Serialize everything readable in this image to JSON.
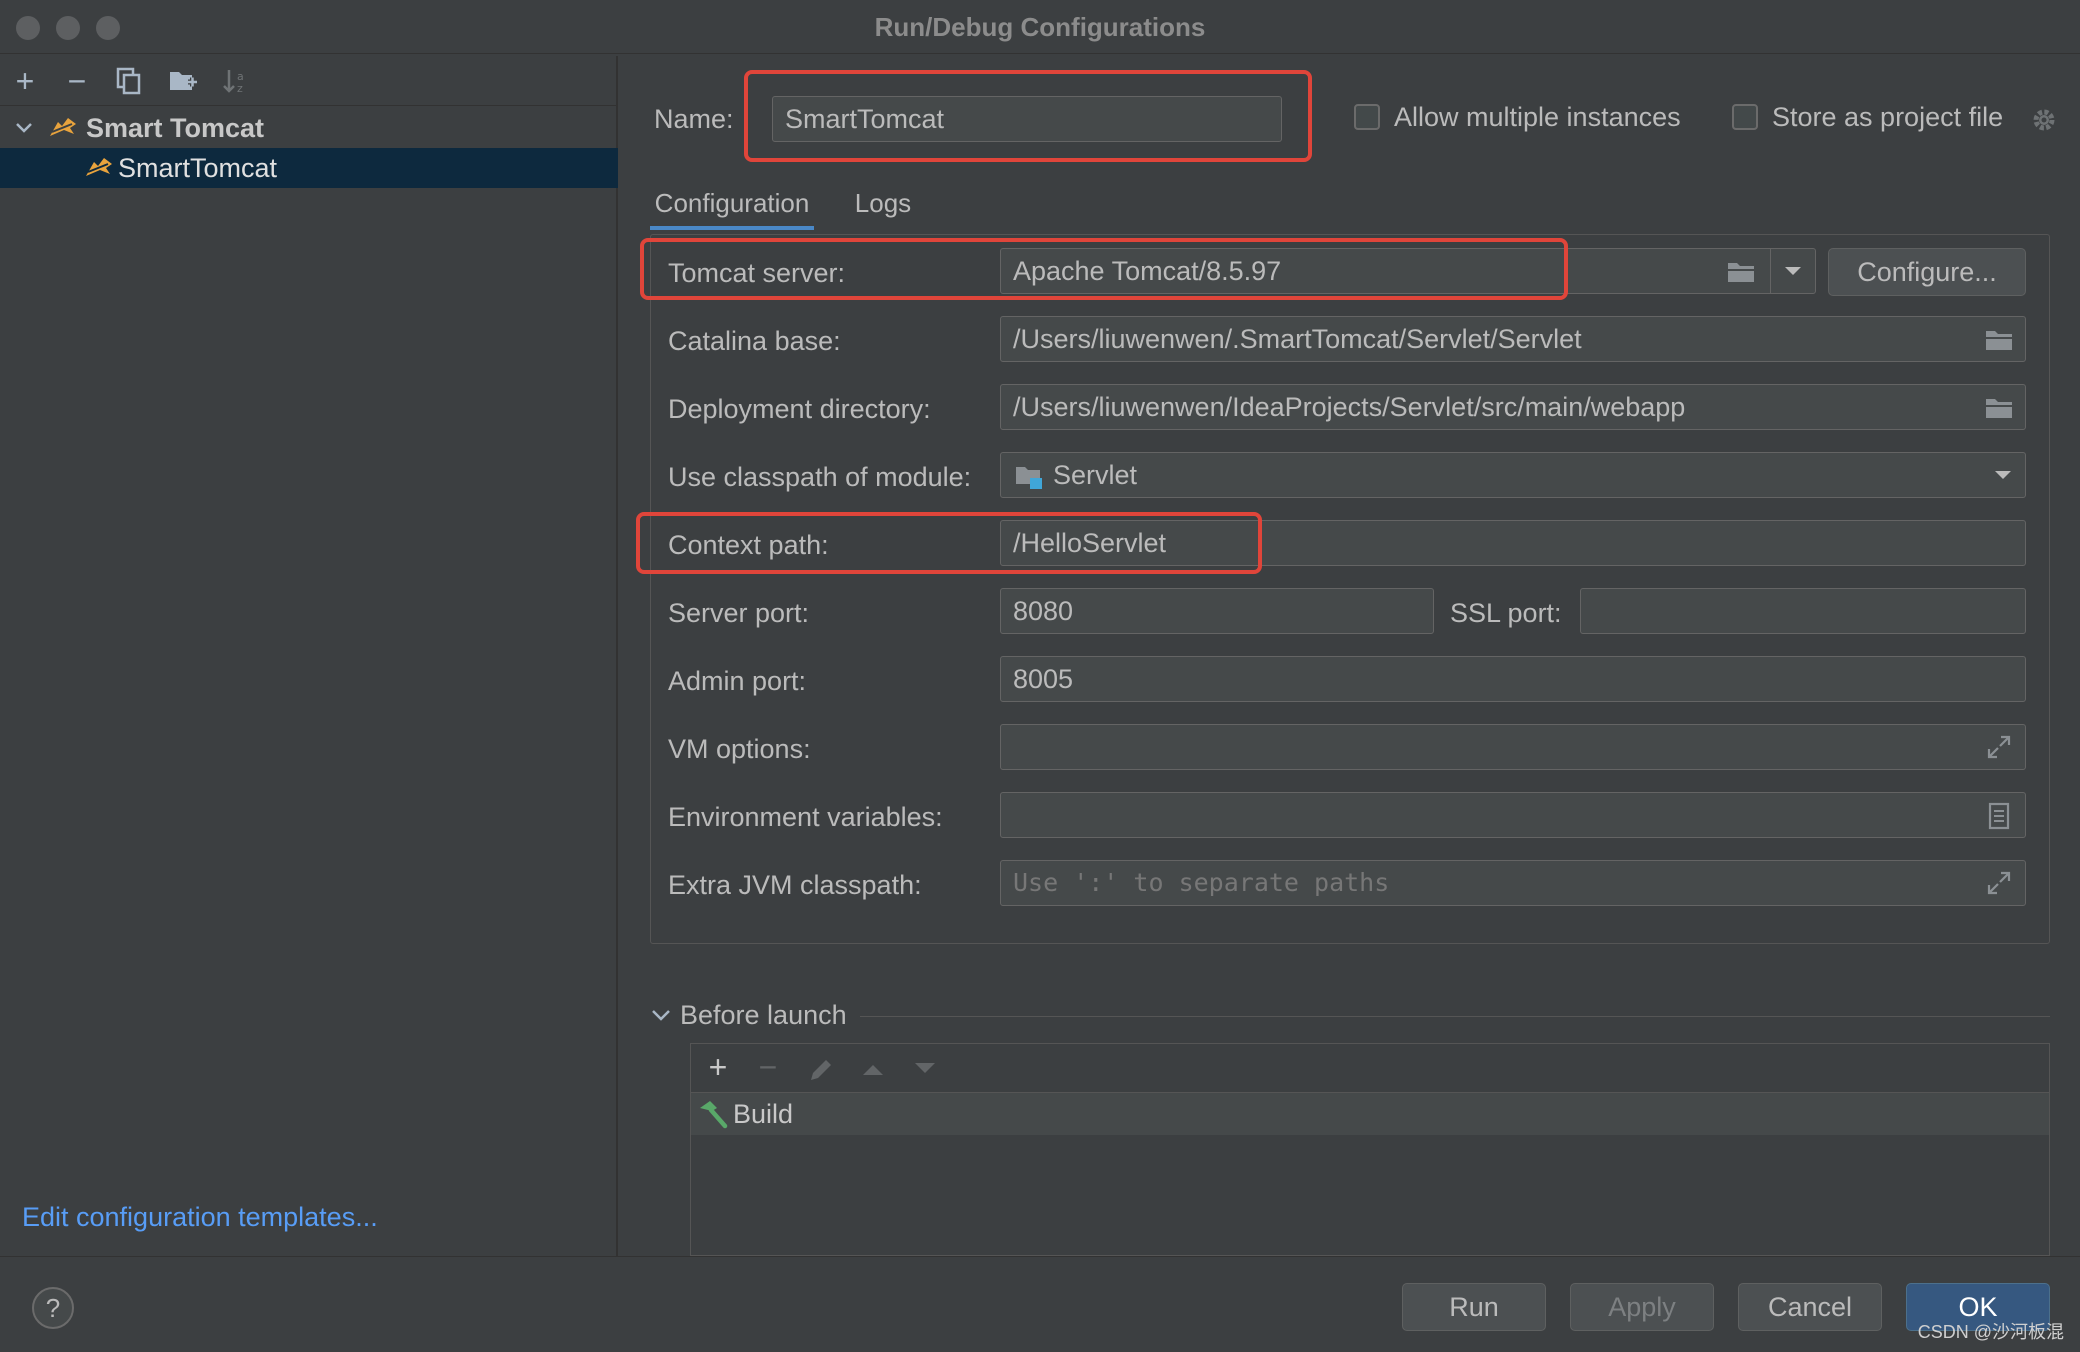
{
  "window": {
    "title": "Run/Debug Configurations"
  },
  "tree": {
    "group_label": "Smart Tomcat",
    "child_label": "SmartTomcat"
  },
  "left_footer": {
    "templates_link": "Edit configuration templates..."
  },
  "header": {
    "name_label": "Name:",
    "name_value": "SmartTomcat",
    "allow_multiple_label": "Allow multiple instances",
    "store_project_label": "Store as project file"
  },
  "tabs": [
    {
      "label": "Configuration"
    },
    {
      "label": "Logs"
    }
  ],
  "form": {
    "tomcat_server_label": "Tomcat server:",
    "tomcat_server_value": "Apache Tomcat/8.5.97",
    "configure_button": "Configure...",
    "catalina_base_label": "Catalina base:",
    "catalina_base_value": "/Users/liuwenwen/.SmartTomcat/Servlet/Servlet",
    "deployment_dir_label": "Deployment directory:",
    "deployment_dir_value": "/Users/liuwenwen/IdeaProjects/Servlet/src/main/webapp",
    "classpath_module_label": "Use classpath of module:",
    "classpath_module_value": "Servlet",
    "context_path_label": "Context path:",
    "context_path_value": "/HelloServlet",
    "server_port_label": "Server port:",
    "server_port_value": "8080",
    "ssl_port_label": "SSL port:",
    "ssl_port_value": "",
    "admin_port_label": "Admin port:",
    "admin_port_value": "8005",
    "vm_options_label": "VM options:",
    "vm_options_value": "",
    "env_vars_label": "Environment variables:",
    "env_vars_value": "",
    "extra_jvm_label": "Extra JVM classpath:",
    "extra_jvm_placeholder": "Use ':' to separate paths"
  },
  "before_launch": {
    "title": "Before launch",
    "items": [
      {
        "label": "Build"
      }
    ]
  },
  "footer_buttons": {
    "run": "Run",
    "apply": "Apply",
    "cancel": "Cancel",
    "ok": "OK",
    "help": "?"
  },
  "watermark": "CSDN @沙河板混",
  "colors": {
    "background": "#3c3f41",
    "field": "#45494a",
    "selection": "#0d293e",
    "accent": "#4a88c7",
    "link": "#589df6",
    "highlight_box": "#e0453a",
    "primary_button": "#365880"
  }
}
